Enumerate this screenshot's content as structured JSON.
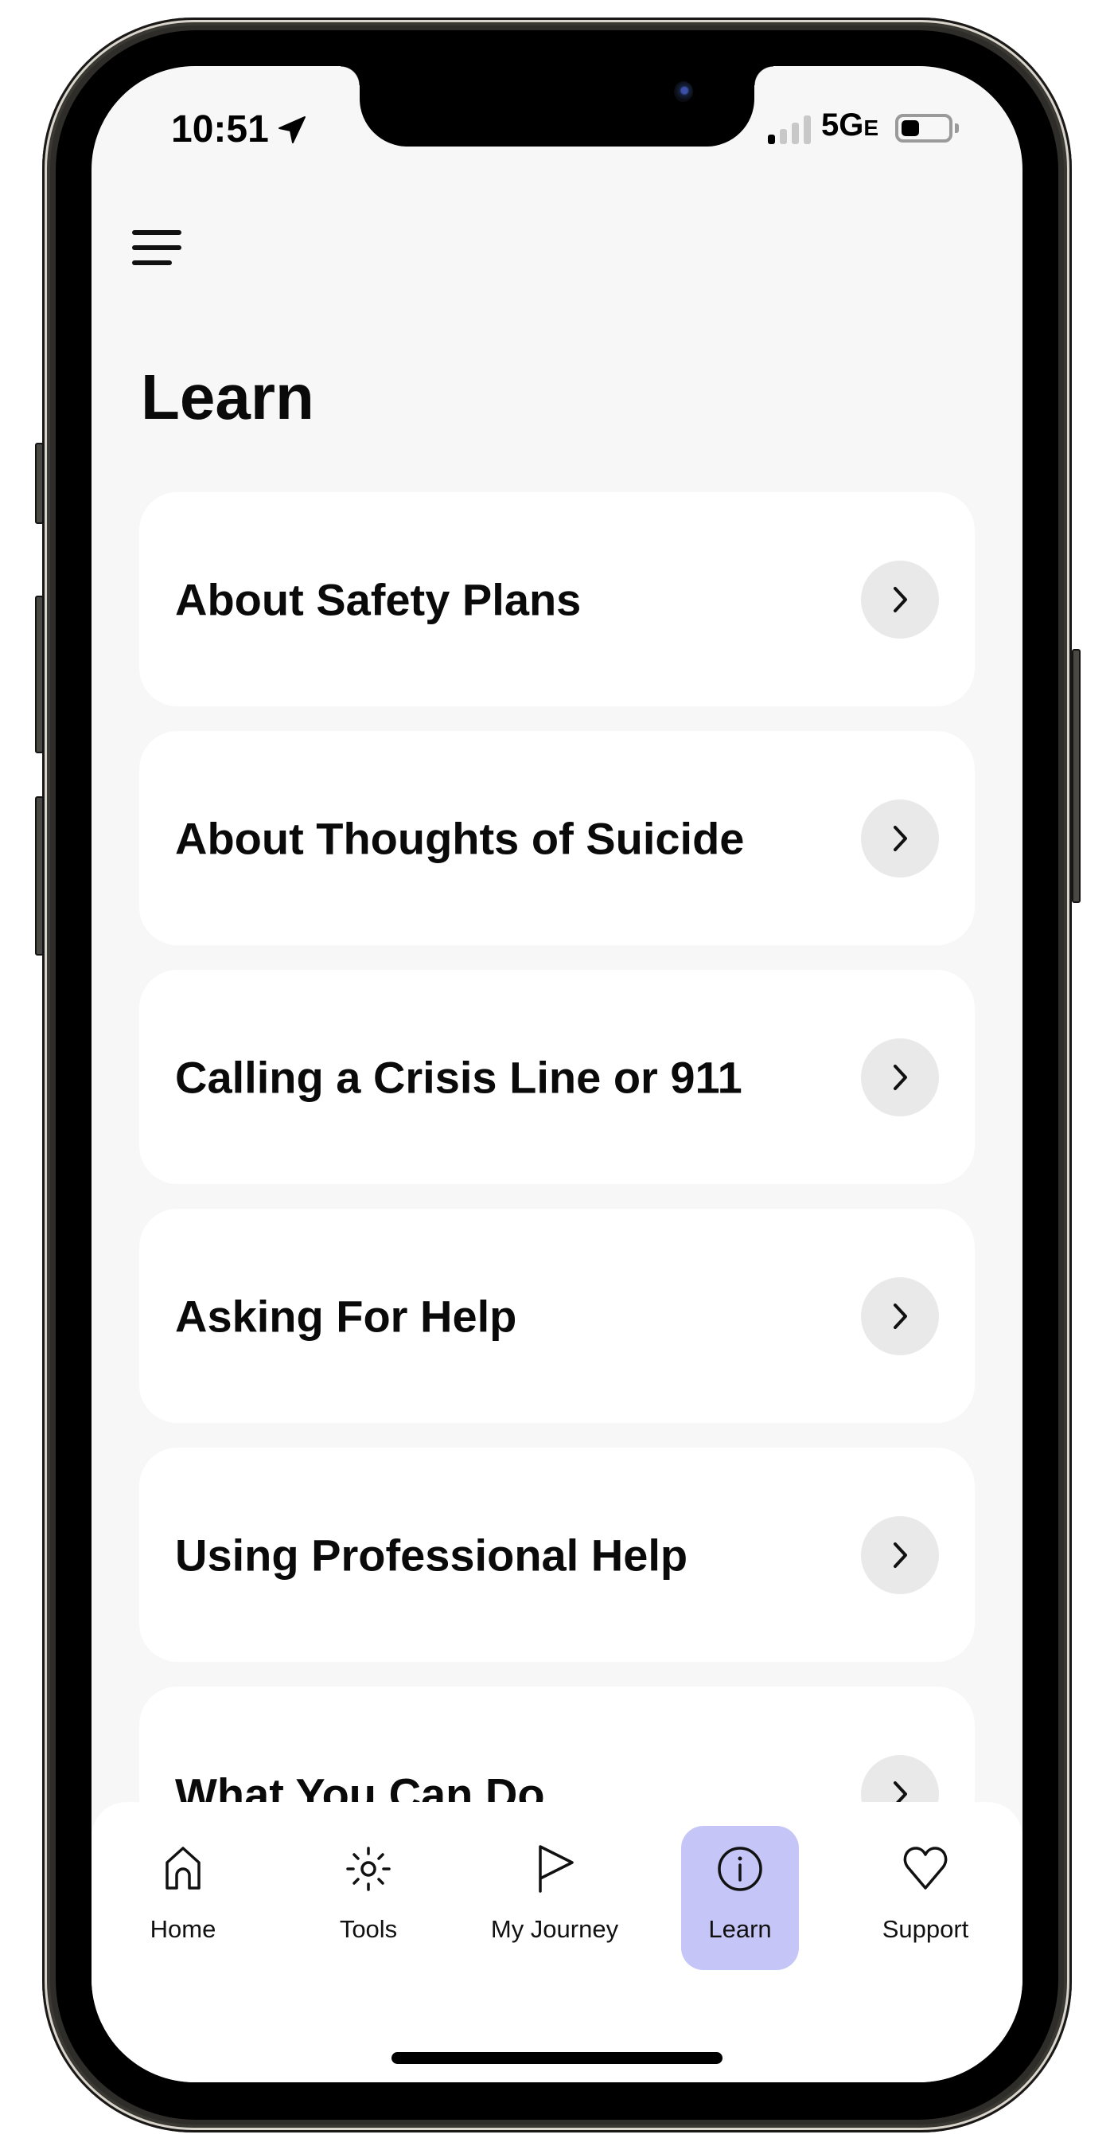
{
  "status_bar": {
    "time": "10:51",
    "location_icon": "location-arrow-icon",
    "signal_bars_active": 1,
    "signal_bars_total": 4,
    "network": "5G",
    "network_suffix": "E",
    "battery_level_percent": 25
  },
  "header": {
    "menu_icon": "hamburger-menu-icon",
    "title": "Learn"
  },
  "items": [
    {
      "label": "About Safety Plans",
      "icon": "chevron-right-icon"
    },
    {
      "label": "About Thoughts of Suicide",
      "icon": "chevron-right-icon"
    },
    {
      "label": "Calling a Crisis Line or 911",
      "icon": "chevron-right-icon"
    },
    {
      "label": "Asking For Help",
      "icon": "chevron-right-icon"
    },
    {
      "label": "Using Professional Help",
      "icon": "chevron-right-icon"
    },
    {
      "label": "What You Can Do",
      "icon": "chevron-right-icon"
    }
  ],
  "tabbar": {
    "active_color": "#c5c5f8",
    "active_tab": "Learn",
    "tabs": [
      {
        "label": "Home",
        "icon": "home-icon"
      },
      {
        "label": "Tools",
        "icon": "sun-icon"
      },
      {
        "label": "My Journey",
        "icon": "flag-icon"
      },
      {
        "label": "Learn",
        "icon": "info-icon"
      },
      {
        "label": "Support",
        "icon": "heart-icon"
      }
    ]
  },
  "colors": {
    "screen_background": "#f7f7f7",
    "card_background": "#ffffff",
    "arrow_button_background": "#e9e9e9",
    "text": "#0a0a0a"
  }
}
